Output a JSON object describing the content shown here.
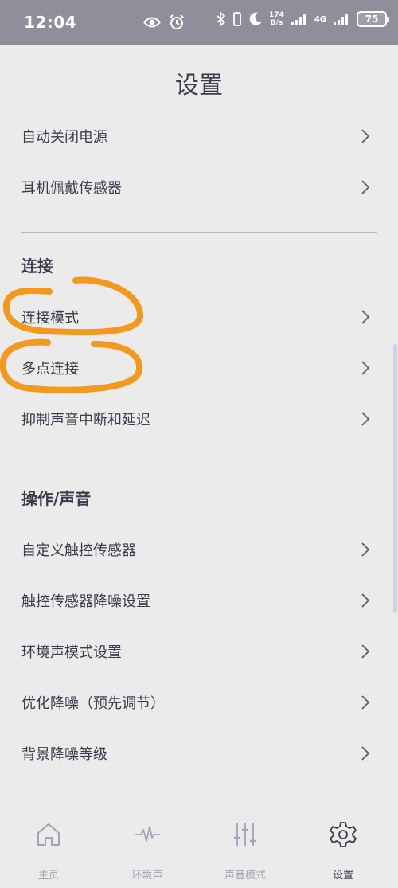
{
  "status_bar": {
    "time": "12:04",
    "speed_value": "174",
    "speed_unit": "B/s",
    "network": "4G",
    "battery": "75",
    "icons": [
      "eye-icon",
      "alarm-icon",
      "bluetooth-icon",
      "vibrate-icon",
      "moon-icon",
      "signal-icon",
      "signal-icon"
    ]
  },
  "header": {
    "title": "设置"
  },
  "sections": {
    "top": {
      "items": [
        {
          "label": "自动关闭电源"
        },
        {
          "label": "耳机佩戴传感器"
        }
      ]
    },
    "connection": {
      "title": "连接",
      "items": [
        {
          "label": "连接模式"
        },
        {
          "label": "多点连接"
        },
        {
          "label": "抑制声音中断和延迟"
        }
      ]
    },
    "operation": {
      "title": "操作/声音",
      "items": [
        {
          "label": "自定义触控传感器"
        },
        {
          "label": "触控传感器降噪设置"
        },
        {
          "label": "环境声模式设置"
        },
        {
          "label": "优化降噪（预先调节）"
        },
        {
          "label": "背景降噪等级"
        }
      ]
    }
  },
  "bottom_nav": {
    "items": [
      {
        "label": "主页",
        "icon": "home-icon"
      },
      {
        "label": "环境声",
        "icon": "waveform-icon"
      },
      {
        "label": "声音模式",
        "icon": "equalizer-icon"
      },
      {
        "label": "设置",
        "icon": "gear-icon",
        "active": true
      }
    ]
  },
  "colors": {
    "status_bar": "#8f8f9c",
    "background": "#ebebeb",
    "text": "#3a3c4a",
    "annotation": "#f29a1e",
    "inactive_nav": "#a4a4b4"
  }
}
